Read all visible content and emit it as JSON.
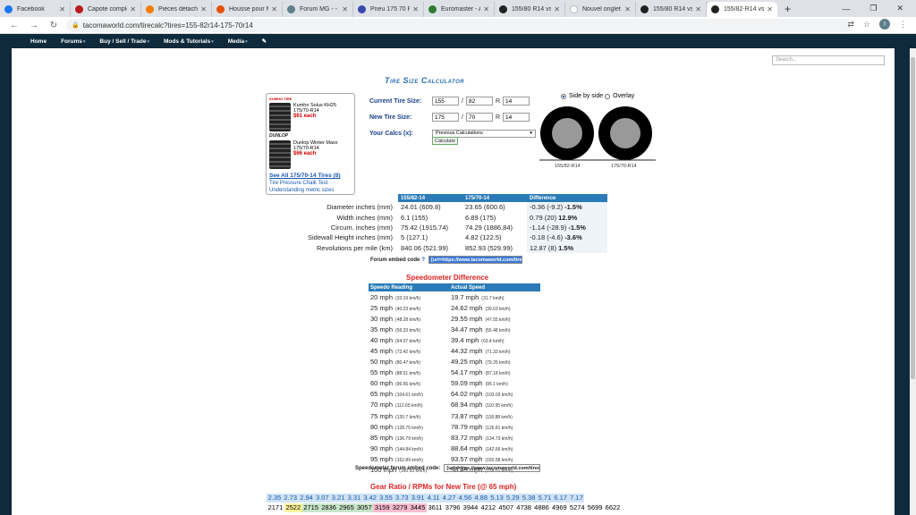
{
  "browser": {
    "tabs": [
      {
        "label": "Facebook",
        "color": "#1877f2"
      },
      {
        "label": "Capote complète...",
        "color": "#b71c1c"
      },
      {
        "label": "Pièces détachées...",
        "color": "#f57c00"
      },
      {
        "label": "Housse pour Mi...",
        "color": "#e65100"
      },
      {
        "label": "Forum MG - - M...",
        "color": "#607d8b"
      },
      {
        "label": "Pneu 175 70 R14...",
        "color": "#3949ab"
      },
      {
        "label": "Euromaster - Ach...",
        "color": "#2e7d32"
      },
      {
        "label": "155/80 R14 vs 1...",
        "color": "#212121"
      },
      {
        "label": "Nouvel onglet",
        "color": "#ffffff"
      },
      {
        "label": "155/80 R14 vs 1...",
        "color": "#212121"
      },
      {
        "label": "155/82-R14 vs 1...",
        "color": "#212121"
      }
    ],
    "new_tab": "+",
    "url": "tacomaworld.com/tirecalc?tires=155-82r14-175-70r14",
    "avatar_letter": "I"
  },
  "site_nav": {
    "items": [
      "Home",
      "Forums",
      "Buy / Sell / Trade",
      "Mods & Tutorials",
      "Media"
    ],
    "search_placeholder": "Search..."
  },
  "calculator": {
    "title": "Tire Size Calculator",
    "current_label": "Current Tire Size:",
    "new_label": "New Tire Size:",
    "calcs_label": "Your Calcs (x):",
    "current": {
      "width": "155",
      "ratio": "82",
      "rim": "14"
    },
    "new": {
      "width": "175",
      "ratio": "70",
      "rim": "14"
    },
    "sep_slash": "/",
    "sep_r": "R",
    "calcs_value": "Previous Calculations",
    "calculate_button": "Calculate",
    "view_side": "Side by side",
    "view_overlay": "Overlay",
    "tire1_label": "155/82-R14",
    "tire2_label": "175/70-R14"
  },
  "ad": {
    "brand_top": "KUMHO TIRE",
    "item1": {
      "name": "Kumho Solus KH25",
      "size": "175/70-R14",
      "price": "$61 each"
    },
    "brand_mid": "DUNLOP",
    "item2": {
      "name": "Dunlop Winter Maxx",
      "size": "175/70-R14",
      "price": "$66 each"
    },
    "see_all": "See All 175/70-14 Tires (8)",
    "link1": "Tire Pressure Chalk Test",
    "link2": "Understanding metric sizes"
  },
  "comparison": {
    "headers": [
      "",
      "155/82-14",
      "175/70-14",
      "Difference"
    ],
    "rows": [
      {
        "label": "Diameter inches (mm)",
        "a": "24.01 (609.8)",
        "b": "23.65 (600.6)",
        "diff": "-0.36 (-9.2)",
        "pct": "-1.5%"
      },
      {
        "label": "Width inches (mm)",
        "a": "6.1 (155)",
        "b": "6.89 (175)",
        "diff": "0.79 (20)",
        "pct": "12.9%"
      },
      {
        "label": "Circum. inches (mm)",
        "a": "75.42 (1915.74)",
        "b": "74.29 (1886.84)",
        "diff": "-1.14 (-28.9)",
        "pct": "-1.5%"
      },
      {
        "label": "Sidewall Height inches (mm)",
        "a": "5 (127.1)",
        "b": "4.82 (122.5)",
        "diff": "-0.18 (-4.6)",
        "pct": "-3.6%"
      },
      {
        "label": "Revolutions per mile (km)",
        "a": "840.06 (521.99)",
        "b": "852.93 (529.99)",
        "diff": "12.87 (8)",
        "pct": "1.5%"
      }
    ],
    "embed_label": "Forum embed code",
    "embed_help": "?",
    "embed_value": "[url=https://www.tacomaworld.com/tirecalc"
  },
  "speedo": {
    "title": "Speedometer Difference",
    "headers": [
      "Speedo Reading",
      "Actual Speed"
    ],
    "rows": [
      {
        "mph": "20 mph",
        "kmh": "(32.19 km/h)",
        "amph": "19.7 mph",
        "akmh": "(31.7 km/h)"
      },
      {
        "mph": "25 mph",
        "kmh": "(40.23 km/h)",
        "amph": "24.62 mph",
        "akmh": "(39.63 km/h)"
      },
      {
        "mph": "30 mph",
        "kmh": "(48.28 km/h)",
        "amph": "29.55 mph",
        "akmh": "(47.55 km/h)"
      },
      {
        "mph": "35 mph",
        "kmh": "(56.33 km/h)",
        "amph": "34.47 mph",
        "akmh": "(55.48 km/h)"
      },
      {
        "mph": "40 mph",
        "kmh": "(64.37 km/h)",
        "amph": "39.4 mph",
        "akmh": "(63.4 km/h)"
      },
      {
        "mph": "45 mph",
        "kmh": "(72.42 km/h)",
        "amph": "44.32 mph",
        "akmh": "(71.33 km/h)"
      },
      {
        "mph": "50 mph",
        "kmh": "(80.47 km/h)",
        "amph": "49.25 mph",
        "akmh": "(79.25 km/h)"
      },
      {
        "mph": "55 mph",
        "kmh": "(88.51 km/h)",
        "amph": "54.17 mph",
        "akmh": "(87.18 km/h)"
      },
      {
        "mph": "60 mph",
        "kmh": "(96.56 km/h)",
        "amph": "59.09 mph",
        "akmh": "(95.1 km/h)"
      },
      {
        "mph": "65 mph",
        "kmh": "(104.61 km/h)",
        "amph": "64.02 mph",
        "akmh": "(103.03 km/h)"
      },
      {
        "mph": "70 mph",
        "kmh": "(112.65 km/h)",
        "amph": "68.94 mph",
        "akmh": "(110.95 km/h)"
      },
      {
        "mph": "75 mph",
        "kmh": "(120.7 km/h)",
        "amph": "73.87 mph",
        "akmh": "(118.88 km/h)"
      },
      {
        "mph": "80 mph",
        "kmh": "(128.75 km/h)",
        "amph": "78.79 mph",
        "akmh": "(126.81 km/h)"
      },
      {
        "mph": "85 mph",
        "kmh": "(136.79 km/h)",
        "amph": "83.72 mph",
        "akmh": "(134.73 km/h)"
      },
      {
        "mph": "90 mph",
        "kmh": "(144.84 km/h)",
        "amph": "88.64 mph",
        "akmh": "(142.66 km/h)"
      },
      {
        "mph": "95 mph",
        "kmh": "(152.89 km/h)",
        "amph": "93.57 mph",
        "akmh": "(150.58 km/h)"
      },
      {
        "mph": "100 mph",
        "kmh": "(160.93 km/h)",
        "amph": "98.49 mph",
        "akmh": "(158.51 km/h)"
      }
    ],
    "embed_label": "Speedometer forum embed code:",
    "embed_value": "[url=https://www.tacomaworld.com/tirecalc"
  },
  "gear": {
    "title": "Gear Ratio / RPMs for New Tire (@ 65 mph)",
    "ratios": [
      "2.35",
      "2.73",
      "2.94",
      "3.07",
      "3.21",
      "3.31",
      "3.42",
      "3.55",
      "3.73",
      "3.91",
      "4.11",
      "4.27",
      "4.56",
      "4.88",
      "5.13",
      "5.29",
      "5.38",
      "5.71",
      "6.17",
      "7.17"
    ],
    "rpms": [
      "2171",
      "2522",
      "2715",
      "2836",
      "2965",
      "3057",
      "3159",
      "3279",
      "3445",
      "3611",
      "3796",
      "3944",
      "4212",
      "4507",
      "4738",
      "4886",
      "4969",
      "5274",
      "5699",
      "6622"
    ],
    "rpm_colors": [
      "#ffffff",
      "#fff59d",
      "#c8e6c9",
      "#c8e6c9",
      "#c8e6c9",
      "#c8e6c9",
      "#f8bbd0",
      "#f8bbd0",
      "#f8bbd0",
      "#ffffff",
      "#ffffff",
      "#ffffff",
      "#ffffff",
      "#ffffff",
      "#ffffff",
      "#ffffff",
      "#ffffff",
      "#ffffff",
      "#ffffff",
      "#ffffff"
    ],
    "ratio_bg": "#cfe3f5"
  }
}
